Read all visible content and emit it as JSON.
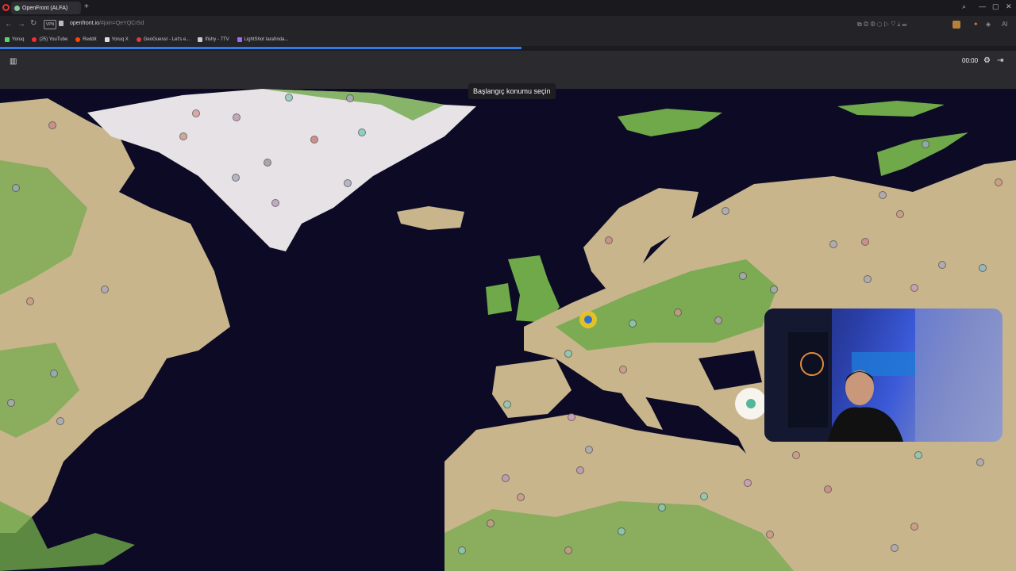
{
  "browser": {
    "tab_title": "OpenFront (ALFA)",
    "new_tab": "+",
    "url_host": "openfront.io",
    "url_path": "/#join=QeYQCrSd",
    "vpn": "VPN",
    "nav": {
      "back": "←",
      "forward": "→",
      "reload": "↻"
    },
    "window": {
      "minimize": "—",
      "maximize": "▢",
      "close": "✕",
      "search": "⌕"
    },
    "bookmarks": [
      {
        "label": "Yoruq",
        "color": "#53d769"
      },
      {
        "label": "(25) YouTube",
        "color": "#ff2b2b"
      },
      {
        "label": "Reddit",
        "color": "#ff4500"
      },
      {
        "label": "Yoruq X",
        "color": "#dddddd"
      },
      {
        "label": "GeoGuessr - Let's e...",
        "color": "#e03a3a"
      },
      {
        "label": "Ifishy - 7TV",
        "color": "#cccccc"
      },
      {
        "label": "LightShot tarafında...",
        "color": "#9b6cf0"
      }
    ],
    "load_progress": 0.513
  },
  "game": {
    "leaderboard_icon": "▥",
    "timer": "00:00",
    "settings_icon": "⚙",
    "exit_icon": "⇥",
    "prompt": "Başlangıç konumu seçin"
  },
  "colors": {
    "ocean": "#0c0a25",
    "land": "#c8b58c",
    "grass": "#6fa94a",
    "ice": "#e6e2e6",
    "accent": "#2f7de0",
    "selected_marker": "#f0c420"
  }
}
